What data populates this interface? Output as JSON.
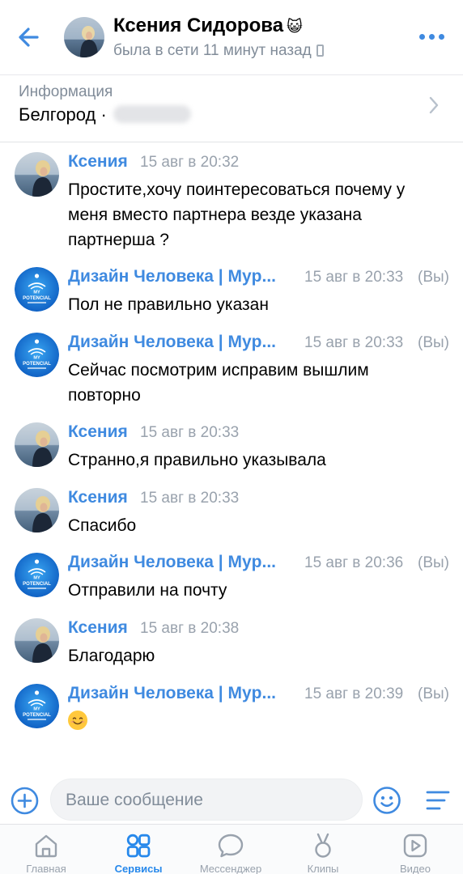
{
  "header": {
    "name": "Ксения Сидорова",
    "name_emoji": "😺",
    "status": "была в сети 11 минут назад"
  },
  "info": {
    "label": "Информация",
    "value": "Белгород ·"
  },
  "messages": [
    {
      "sender": "Ксения",
      "time": "15 авг в 20:32",
      "you": "",
      "text": "Простите,хочу поинтересоваться почему у меня вместо партнера везде указана партнерша ?",
      "avatar": "user-photo"
    },
    {
      "sender": "Дизайн Человека | Myp...",
      "time": "15 авг в 20:33",
      "you": "(Вы)",
      "text": "Пол не правильно указан",
      "avatar": "my-potencial-logo"
    },
    {
      "sender": "Дизайн Человека | Myp...",
      "time": "15 авг в 20:33",
      "you": "(Вы)",
      "text": "Сейчас посмотрим исправим вышлим повторно",
      "avatar": "my-potencial-logo"
    },
    {
      "sender": "Ксения",
      "time": "15 авг в 20:33",
      "you": "",
      "text": "Странно,я правильно указывала",
      "avatar": "user-photo"
    },
    {
      "sender": "Ксения",
      "time": "15 авг в 20:33",
      "you": "",
      "text": "Спасибо",
      "avatar": "user-photo"
    },
    {
      "sender": "Дизайн Человека | Myp...",
      "time": "15 авг в 20:36",
      "you": "(Вы)",
      "text": "Отправили на почту",
      "avatar": "my-potencial-logo"
    },
    {
      "sender": "Ксения",
      "time": "15 авг в 20:38",
      "you": "",
      "text": "Благодарю",
      "avatar": "user-photo"
    },
    {
      "sender": "Дизайн Человека | Myp...",
      "time": "15 авг в 20:39",
      "you": "(Вы)",
      "text": "",
      "avatar": "my-potencial-logo",
      "emoji": "smiling-face-emoji"
    }
  ],
  "logo": {
    "top_text": "MY",
    "bottom_text": "POTENCIAL"
  },
  "composer": {
    "placeholder": "Ваше сообщение"
  },
  "tabs": [
    {
      "label": "Главная",
      "icon": "home-icon",
      "active": false
    },
    {
      "label": "Сервисы",
      "icon": "services-icon",
      "active": true
    },
    {
      "label": "Мессенджер",
      "icon": "messenger-icon",
      "active": false
    },
    {
      "label": "Клипы",
      "icon": "clips-icon",
      "active": false
    },
    {
      "label": "Видео",
      "icon": "video-icon",
      "active": false
    }
  ],
  "colors": {
    "accent": "#3f8ae0",
    "sender_user": "#3f8ae0",
    "sender_group": "#3f8ae0",
    "active_tab": "#2688eb",
    "secondary_text": "#818c99"
  }
}
